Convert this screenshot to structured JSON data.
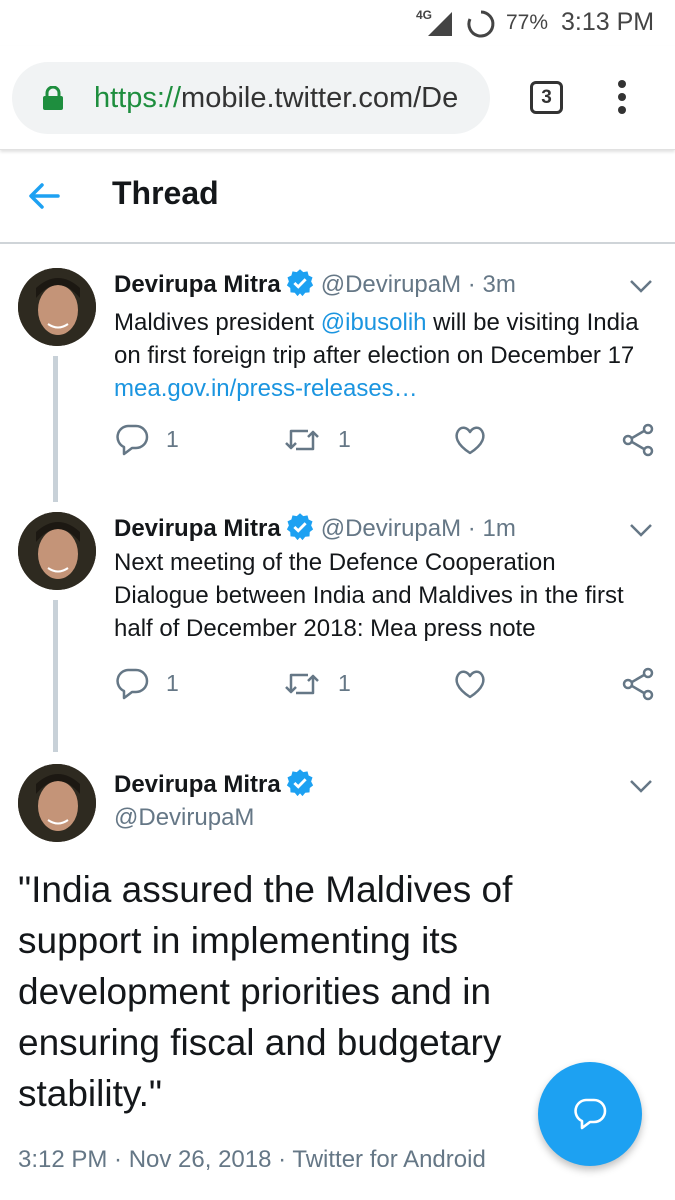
{
  "status_bar": {
    "network": "4G",
    "battery": "77%",
    "time": "3:13 PM"
  },
  "browser": {
    "url_scheme": "https://",
    "url_rest": "mobile.twitter.com/De",
    "tab_count": "3"
  },
  "header": {
    "title": "Thread"
  },
  "tweets": [
    {
      "author": "Devirupa Mitra",
      "handle": "@DevirupaM",
      "separator": "·",
      "time": "3m",
      "text_before": "Maldives president ",
      "mention": "@ibusolih",
      "text_middle": " will be visiting India on first foreign trip after election on December 17 ",
      "link": "mea.gov.in/press-releases…",
      "replies": "1",
      "retweets": "1"
    },
    {
      "author": "Devirupa Mitra",
      "handle": "@DevirupaM",
      "separator": "·",
      "time": "1m",
      "text": "Next meeting of the Defence Cooperation Dialogue between India and Maldives in the first half of December 2018: Mea press note",
      "replies": "1",
      "retweets": "1"
    }
  ],
  "main_tweet": {
    "author": "Devirupa Mitra",
    "handle": "@DevirupaM",
    "text": "\"India assured the Maldives of support in implementing its development priorities and in ensuring fiscal and budgetary stability.\"",
    "timestamp": "3:12 PM · Nov 26, 2018 · Twitter for Android"
  },
  "colors": {
    "accent": "#1da1f2",
    "link": "#1b95e0",
    "secure_green": "#1e8e3e",
    "muted": "#657786"
  },
  "icons": [
    "network-signal-icon",
    "sync-icon",
    "lock-icon",
    "overflow-menu-icon",
    "back-arrow-icon",
    "verified-badge-icon",
    "chevron-down-icon",
    "reply-icon",
    "retweet-icon",
    "like-icon",
    "share-icon",
    "compose-reply-icon"
  ]
}
